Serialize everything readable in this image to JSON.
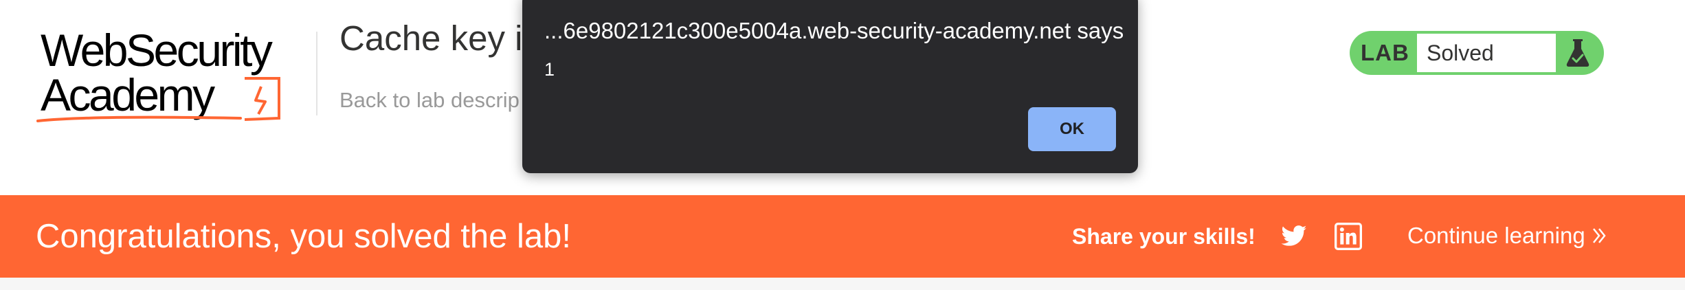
{
  "header": {
    "logo": {
      "line1": "WebSecurity",
      "line2": "Academy",
      "icon": "lightning-bolt-box-icon"
    },
    "lab_title": "Cache key in",
    "back_link": "Back to lab descrip"
  },
  "lab_status": {
    "label": "LAB",
    "state": "Solved",
    "icon": "flask-check-icon",
    "color": "#70d16d"
  },
  "dialog": {
    "origin": "...6e9802121c300e5004a.web-security-academy.net says",
    "message": "1",
    "ok_label": "OK"
  },
  "banner": {
    "message": "Congratulations, you solved the lab!",
    "share_label": "Share your skills!",
    "twitter_icon": "twitter-icon",
    "linkedin_icon": "linkedin-icon",
    "continue_label": "Continue learning",
    "color": "#ff6633"
  }
}
